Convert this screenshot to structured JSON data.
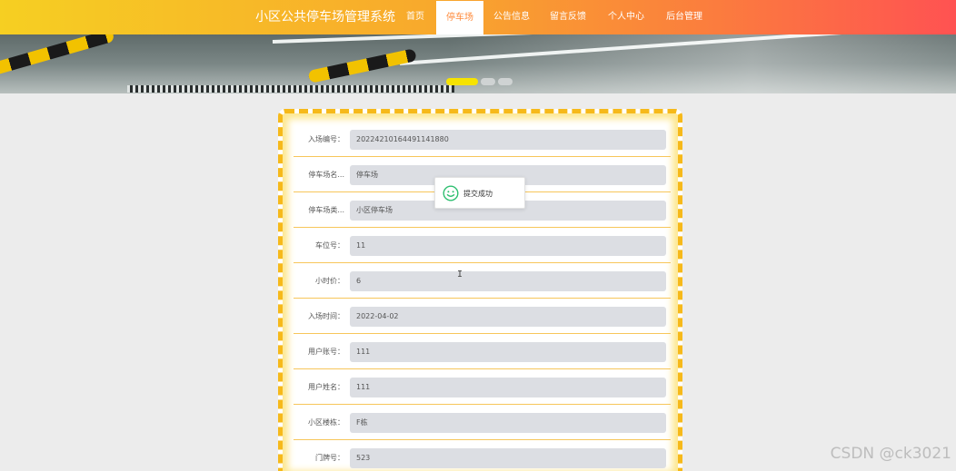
{
  "header": {
    "title": "小区公共停车场管理系统",
    "nav": [
      {
        "label": "首页"
      },
      {
        "label": "停车场",
        "active": true
      },
      {
        "label": "公告信息"
      },
      {
        "label": "留言反馈"
      },
      {
        "label": "个人中心"
      },
      {
        "label": "后台管理"
      }
    ]
  },
  "banner": {
    "slide_count": 3,
    "active_slide": 1
  },
  "form": {
    "fields": [
      {
        "label": "入场编号：",
        "value": "20224210164491141880"
      },
      {
        "label": "停车场名...",
        "value": "停车场"
      },
      {
        "label": "停车场类...",
        "value": "小区停车场"
      },
      {
        "label": "车位号：",
        "value": "11"
      },
      {
        "label": "小时价：",
        "value": "6"
      },
      {
        "label": "入场时间：",
        "value": "2022-04-02"
      },
      {
        "label": "用户账号：",
        "value": "111"
      },
      {
        "label": "用户姓名：",
        "value": "111"
      },
      {
        "label": "小区楼栋：",
        "value": "F栋"
      },
      {
        "label": "门牌号：",
        "value": "523"
      }
    ]
  },
  "toast": {
    "message": "提交成功",
    "icon": "smile-icon"
  },
  "cursor": {
    "glyph": "I"
  },
  "watermark": "CSDN @ck3021",
  "colors": {
    "accent": "#f6b91a",
    "nav_gradient_start": "#f6cf22",
    "nav_gradient_end": "#ff5252",
    "toast_icon": "#2fbf71",
    "active_dot": "#f7e300"
  }
}
